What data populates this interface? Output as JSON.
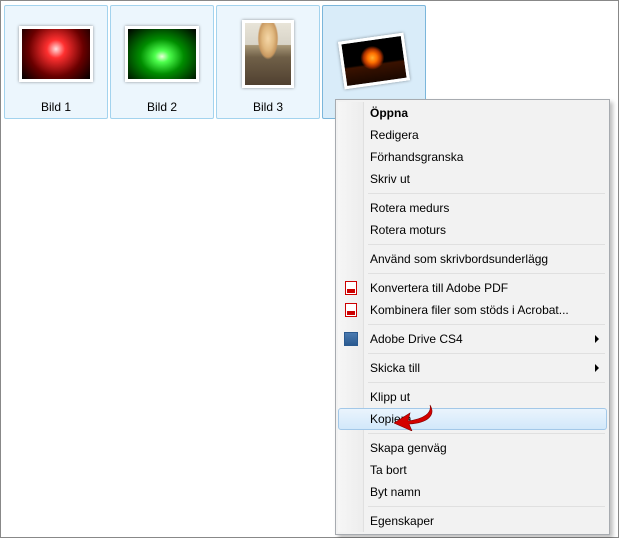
{
  "thumbs": [
    {
      "label": "Bild 1"
    },
    {
      "label": "Bild 2"
    },
    {
      "label": "Bild 3"
    },
    {
      "label": ""
    }
  ],
  "menu": {
    "open": "Öppna",
    "edit": "Redigera",
    "preview": "Förhandsgranska",
    "print": "Skriv ut",
    "rotate_cw": "Rotera medurs",
    "rotate_ccw": "Rotera moturs",
    "set_wallpaper": "Använd som skrivbordsunderlägg",
    "convert_pdf": "Konvertera till Adobe PDF",
    "combine_acrobat": "Kombinera filer som stöds i Acrobat...",
    "adobe_drive": "Adobe Drive CS4",
    "send_to": "Skicka till",
    "cut": "Klipp ut",
    "copy": "Kopiera",
    "create_shortcut": "Skapa genväg",
    "delete": "Ta bort",
    "rename": "Byt namn",
    "properties": "Egenskaper"
  }
}
